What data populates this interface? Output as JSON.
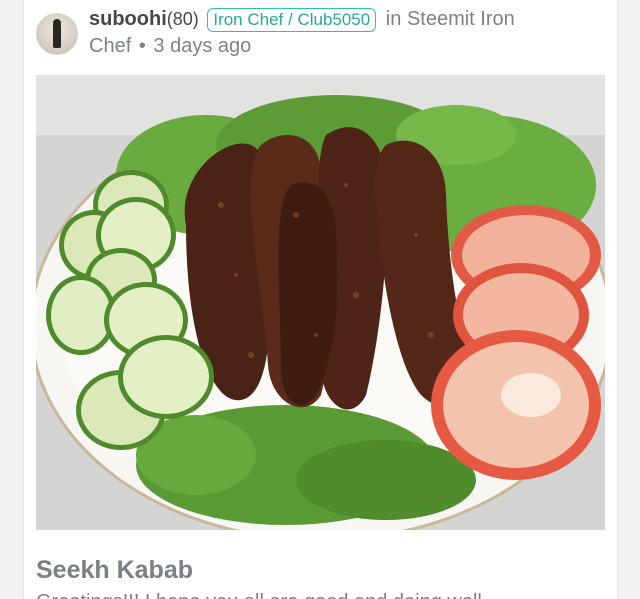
{
  "post": {
    "author": "suboohi",
    "reputation": "(80)",
    "tag": "Iron Chef / Club5050",
    "in_text": "in",
    "community_line1": "Steemit Iron",
    "community_line2": "Chef",
    "separator": "•",
    "timestamp": "3 days ago",
    "title": "Seekh Kabab",
    "snippet": "Greetings!!! I hope you all are good and doing well"
  },
  "colors": {
    "tag_border": "#2dc1a9",
    "text_muted": "#7d8289",
    "author": "#44484e"
  }
}
